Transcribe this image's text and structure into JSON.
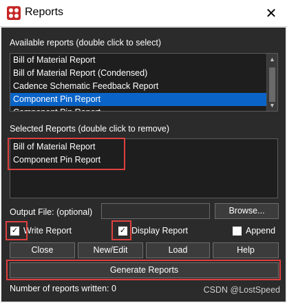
{
  "window": {
    "title": "Reports",
    "close_glyph": "✕",
    "icon": "app-logo-icon",
    "accent_color": "#c62828"
  },
  "available": {
    "label": "Available reports (double click to select)",
    "items": [
      "Bill of Material Report",
      "Bill of Material Report (Condensed)",
      "Cadence Schematic Feedback Report",
      "Component Pin Report",
      "Component Pin Report"
    ],
    "selected_index": 3
  },
  "selected": {
    "label": "Selected Reports (double click to remove)",
    "items": [
      "Bill of Material Report",
      "Component Pin Report"
    ]
  },
  "output": {
    "label": "Output File: (optional)",
    "value": "",
    "browse_label": "Browse..."
  },
  "options": {
    "write_report": {
      "label": "Write Report",
      "checked": true
    },
    "display_report": {
      "label": "Display Report",
      "checked": true
    },
    "append": {
      "label": "Append",
      "checked": false
    }
  },
  "buttons": {
    "close": "Close",
    "new_edit": "New/Edit",
    "load": "Load",
    "help": "Help",
    "generate": "Generate Reports"
  },
  "status": {
    "text": "Number of reports written: 0"
  },
  "watermark": "CSDN @LostSpeed",
  "colors": {
    "highlight": "#0a64c8",
    "annotation_red": "#e04040"
  }
}
